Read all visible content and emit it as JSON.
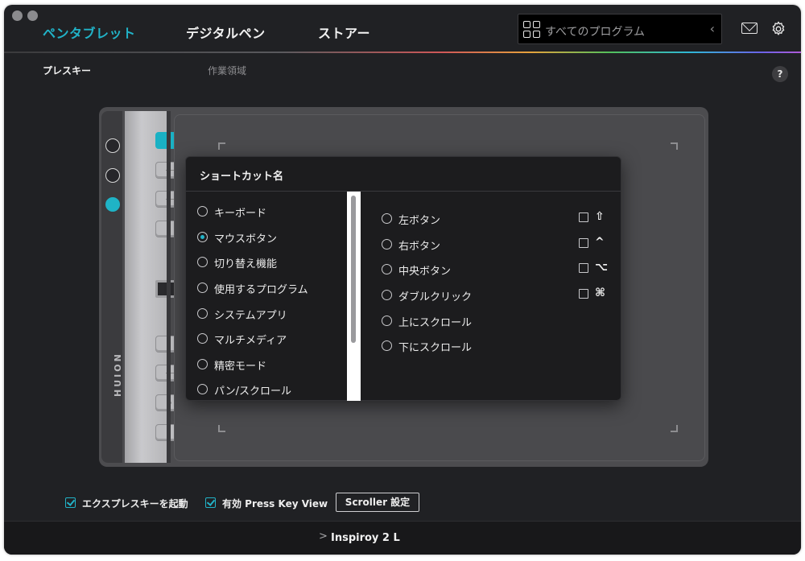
{
  "nav": {
    "tabs": [
      {
        "label": "ペンタブレット",
        "active": true
      },
      {
        "label": "デジタルペン",
        "active": false
      },
      {
        "label": "ストアー",
        "active": false
      }
    ],
    "program_selector": {
      "label": "すべてのプログラム",
      "icon": "grid-icon"
    },
    "icons": [
      "mail-icon",
      "gear-icon"
    ]
  },
  "subtabs": {
    "press_keys": "プレスキー",
    "work_area": "作業領域",
    "help_label": "?"
  },
  "tablet": {
    "brand": "HUION",
    "selected_key_index": 0,
    "selected_circle_index": 2
  },
  "dialog": {
    "title": "ショートカット名",
    "categories": [
      {
        "label": "キーボード",
        "selected": false
      },
      {
        "label": "マウスボタン",
        "selected": true
      },
      {
        "label": "切り替え機能",
        "selected": false
      },
      {
        "label": "使用するプログラム",
        "selected": false
      },
      {
        "label": "システムアプリ",
        "selected": false
      },
      {
        "label": "マルチメディア",
        "selected": false
      },
      {
        "label": "精密モード",
        "selected": false
      },
      {
        "label": "パン/スクロール",
        "selected": false
      }
    ],
    "options": [
      {
        "label": "左ボタン"
      },
      {
        "label": "右ボタン"
      },
      {
        "label": "中央ボタン"
      },
      {
        "label": "ダブルクリック"
      },
      {
        "label": "上にスクロール"
      },
      {
        "label": "下にスクロール"
      }
    ],
    "modifiers": [
      {
        "symbol": "⇧",
        "checked": false
      },
      {
        "symbol": "^",
        "checked": false
      },
      {
        "symbol": "⌥",
        "checked": false
      },
      {
        "symbol": "⌘",
        "checked": false
      }
    ]
  },
  "bottom": {
    "express_keys_checkbox": {
      "label": "エクスプレスキーを起動",
      "checked": true
    },
    "press_key_view_checkbox": {
      "label": "有効 Press Key View",
      "checked": true
    },
    "scroller_button": "Scroller 設定"
  },
  "footer": {
    "chevron": ">",
    "device_name": "Inspiroy 2 L"
  },
  "colors": {
    "accent": "#21b3c8",
    "background": "#202124",
    "dialog_bg": "#1c1c1e"
  }
}
